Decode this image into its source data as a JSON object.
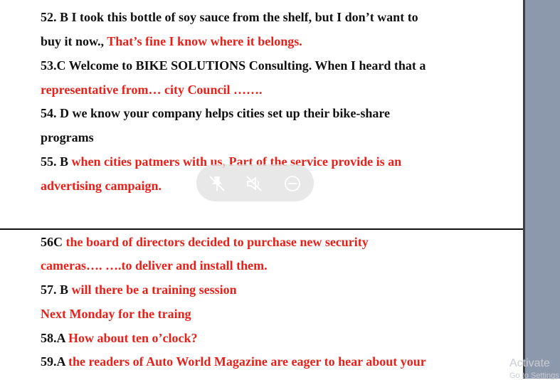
{
  "lines_top": [
    {
      "segments": [
        {
          "t": "52. B   I took this bottle of soy sauce from the shelf, but I don’t want to",
          "c": "blk"
        }
      ]
    },
    {
      "segments": [
        {
          "t": "buy it now., ",
          "c": "blk"
        },
        {
          "t": "That’s fine I know where it belongs.",
          "c": "red"
        }
      ]
    },
    {
      "segments": [
        {
          "t": "53.C  Welcome to BIKE SOLUTIONS Consulting. When I heard that a",
          "c": "blk"
        }
      ]
    },
    {
      "segments": [
        {
          "t": "representative from… city Council …….",
          "c": "red"
        }
      ]
    },
    {
      "segments": [
        {
          "t": "54. D    we know your company helps cities set up their bike-share",
          "c": "blk"
        }
      ]
    },
    {
      "segments": [
        {
          "t": "programs",
          "c": "blk"
        }
      ]
    },
    {
      "segments": [
        {
          "t": "55. B  ",
          "c": "blk"
        },
        {
          "t": "when cities patmers with us, Part of the service provide is an",
          "c": "red"
        }
      ]
    },
    {
      "segments": [
        {
          "t": "advertising campaign.",
          "c": "red"
        }
      ]
    }
  ],
  "lines_bottom": [
    {
      "segments": [
        {
          "t": "56C      ",
          "c": "blk"
        },
        {
          "t": "the board of directors decided to purchase new security",
          "c": "red"
        }
      ]
    },
    {
      "segments": [
        {
          "t": "cameras…. ….to deliver and install them.",
          "c": "red"
        }
      ]
    },
    {
      "segments": [
        {
          "t": "57. B ",
          "c": "blk"
        },
        {
          "t": "will there be a training session",
          "c": "red"
        }
      ]
    },
    {
      "segments": [
        {
          "t": "Next Monday for the traing",
          "c": "red"
        }
      ]
    },
    {
      "segments": [
        {
          "t": "58.A ",
          "c": "blk"
        },
        {
          "t": "How about ten o’clock?",
          "c": "red"
        }
      ]
    },
    {
      "segments": [
        {
          "t": "59.A  ",
          "c": "blk"
        },
        {
          "t": "the readers of Auto World  Magazine are eager to hear about your",
          "c": "red"
        }
      ]
    }
  ],
  "media_controls": [
    "unpin-icon",
    "mute-icon",
    "minimize-icon"
  ],
  "watermark": {
    "line1": "Activate",
    "line2": "Go to Settings"
  },
  "colors": {
    "red": "#e8201a",
    "black": "#111111",
    "sidebar": "#8c98ab"
  }
}
